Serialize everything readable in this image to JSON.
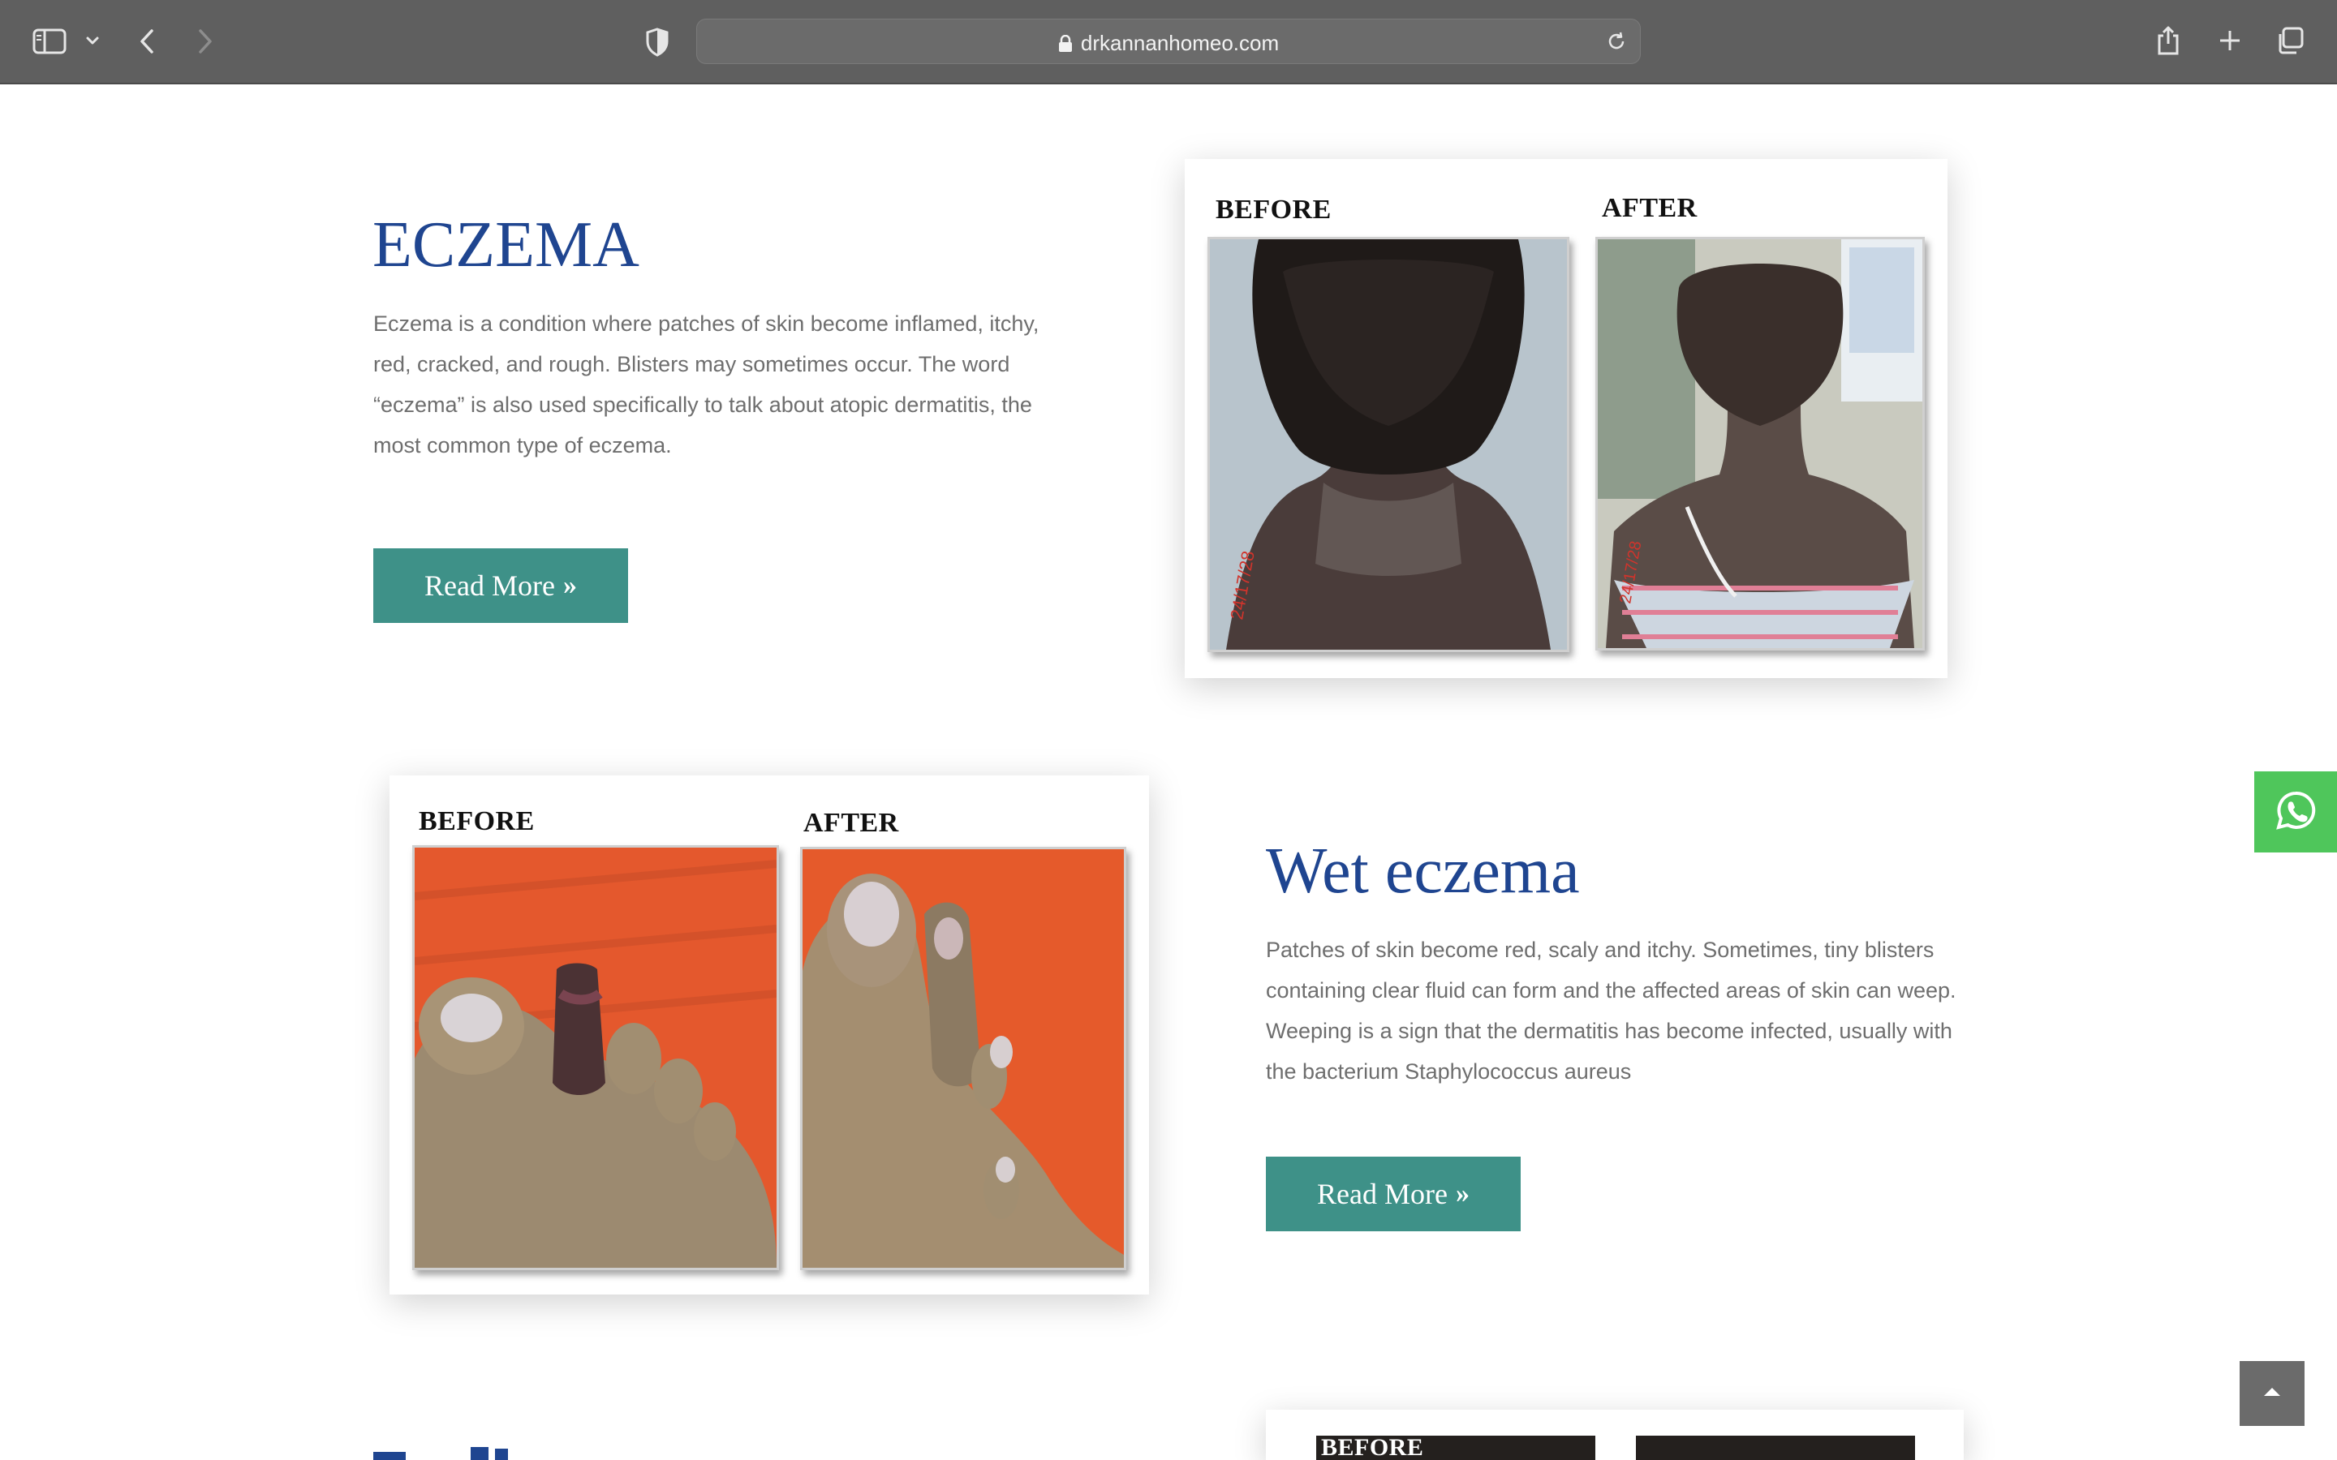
{
  "browser": {
    "url": "drkannanhomeo.com"
  },
  "sections": [
    {
      "title": "ECZEMA",
      "description": "Eczema is a condition where patches of skin become inflamed, itchy, red, cracked, and rough. Blisters may sometimes occur. The word “eczema” is also used specifically to talk about atopic dermatitis, the most common type of eczema.",
      "button_label": "Read More",
      "before_label": "BEFORE",
      "after_label": "AFTER"
    },
    {
      "title": "Wet eczema",
      "description": "Patches of skin become red, scaly and itchy. Sometimes, tiny blisters containing clear fluid can form and the affected areas of skin can weep. Weeping is a sign that the dermatitis has become infected, usually with the bacterium Staphylococcus aureus",
      "button_label": "Read More",
      "before_label": "BEFORE",
      "after_label": "AFTER"
    },
    {
      "before_label": "BEFORE"
    }
  ],
  "icons": {
    "read_more": "double-chevron-right-icon",
    "whatsapp": "whatsapp-icon",
    "scroll_top": "chevron-up-icon"
  },
  "colors": {
    "title": "#1f4590",
    "button": "#3e9188",
    "whatsapp": "#4fc65b",
    "toolbar": "#5f5f5f"
  }
}
